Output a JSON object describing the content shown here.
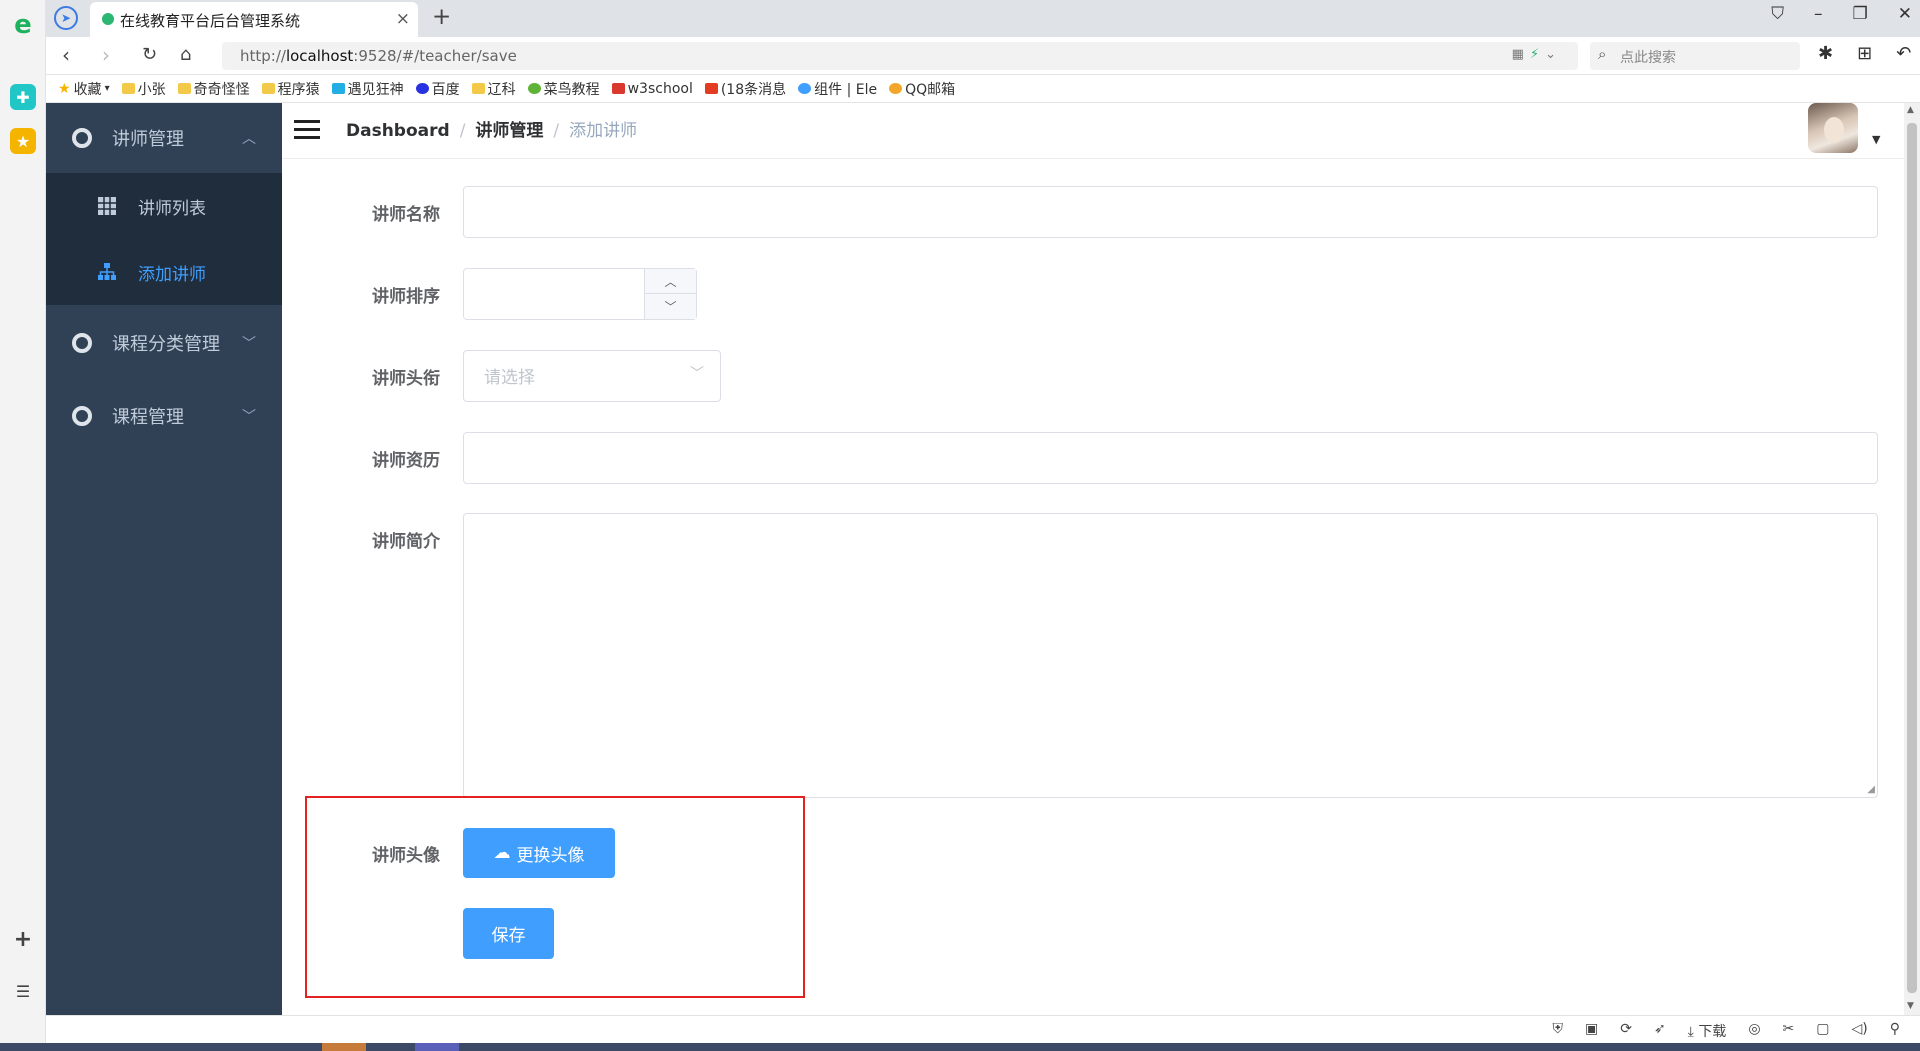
{
  "browser": {
    "tab_title": "在线教育平台后台管理系统",
    "tab_close": "×",
    "tab_new": "+",
    "url_host": "localhost",
    "url_prefix": "http://",
    "url_suffix": ":9528/#/teacher/save",
    "search_placeholder": "点此搜索",
    "bookmarks": [
      "收藏",
      "小张",
      "奇奇怪怪",
      "程序猿",
      "遇见狂神",
      "百度",
      "辽科",
      "菜鸟教程",
      "w3school",
      "(18条消息",
      "组件 | Ele",
      "QQ邮箱"
    ],
    "status_download": "下载"
  },
  "sidebar": {
    "menus": [
      {
        "label": "讲师管理",
        "arrow": "︿"
      },
      {
        "label": "课程分类管理",
        "arrow": "﹀"
      },
      {
        "label": "课程管理",
        "arrow": "﹀"
      }
    ],
    "submenu": [
      {
        "label": "讲师列表"
      },
      {
        "label": "添加讲师"
      }
    ]
  },
  "navbar": {
    "breadcrumb": [
      "Dashboard",
      "讲师管理",
      "添加讲师"
    ],
    "separator": "/"
  },
  "form": {
    "name_label": "讲师名称",
    "name_value": "",
    "sort_label": "讲师排序",
    "sort_value": "",
    "level_label": "讲师头衔",
    "level_placeholder": "请选择",
    "career_label": "讲师资历",
    "career_value": "",
    "intro_label": "讲师简介",
    "intro_value": "",
    "avatar_label": "讲师头像",
    "upload_button": "更换头像",
    "save_button": "保存"
  },
  "colors": {
    "sidebar_bg": "#304156",
    "submenu_bg": "#1f2d3d",
    "primary": "#409eff",
    "highlight": "#e32222"
  }
}
